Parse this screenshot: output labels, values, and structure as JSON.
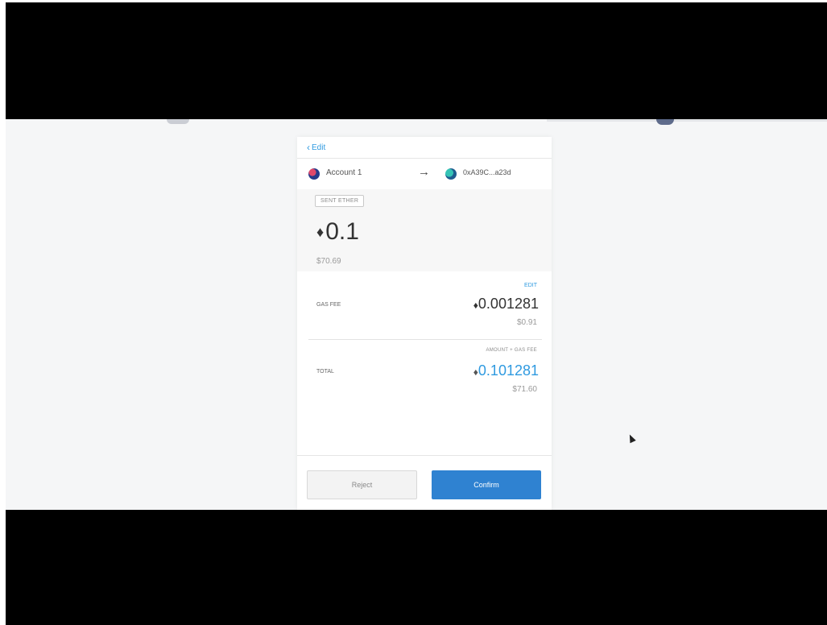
{
  "popup": {
    "edit_label": "Edit",
    "from_account": "Account 1",
    "to_address": "0xA39C...a23d",
    "badge": "SENT ETHER",
    "amount_eth": "0.1",
    "amount_usd": "$70.69",
    "fee_edit": "EDIT",
    "fee_label": "GAS FEE",
    "fee_eth": "0.001281",
    "fee_usd": "$0.91",
    "total_sub": "AMOUNT + GAS FEE",
    "total_label": "TOTAL",
    "total_eth": "0.101281",
    "total_usd": "$71.60",
    "reject_label": "Reject",
    "confirm_label": "Confirm"
  },
  "colors": {
    "accent": "#2f9ae0",
    "confirm": "#2f82d1",
    "letterbox": "#000000"
  },
  "icons": {
    "back": "chevron-left-icon",
    "arrow": "arrow-right-icon",
    "eth": "ethereum-icon",
    "cursor": "mouse-cursor-icon"
  }
}
